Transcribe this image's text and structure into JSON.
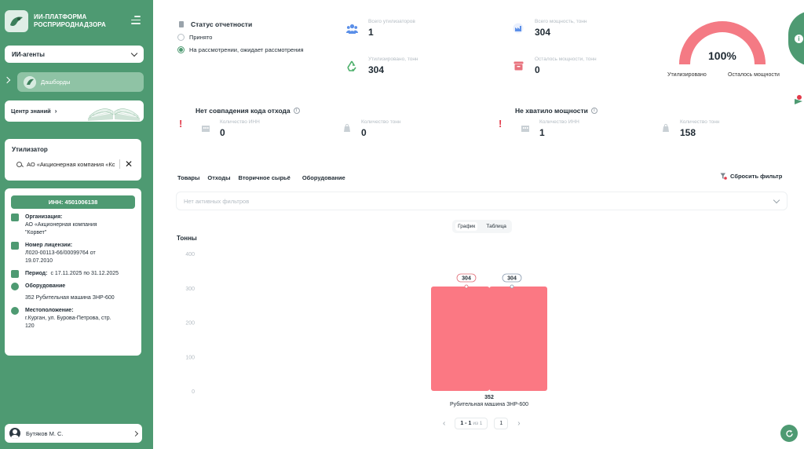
{
  "sidebar": {
    "brand_title_1": "ИИ-ПЛАТФОРМА",
    "brand_title_2": "РОСПРИРОДНАДЗОРА",
    "agents_select": "ИИ-агенты",
    "dashboards": "Дашборды",
    "knowledge": "Центр знаний",
    "knowledge_arrow": "›",
    "utilizer": {
      "title": "Утилизатор",
      "search_value": "АО «Акционерная компания «Корвет»",
      "clear": "✕"
    },
    "details": {
      "inn": "ИНН: 4501006138",
      "org_label": "Организация:",
      "org_value_1": "АО «Акционерная компания",
      "org_value_2": "\"Корвет\"",
      "license_label": "Номер лицензии:",
      "license_value_1": "Л020-00113-66/00099764 от",
      "license_value_2": "19.07.2010",
      "period_label": "Период:",
      "period_value": "с 17.11.2025 по 31.12.2025",
      "equipment_label": "Оборудование",
      "equipment_value": "352 Рубительная машина ЗНР-600",
      "location_label": "Местоположение:",
      "location_value_1": "г.Курган, ул. Бурова-Петрова, стр.",
      "location_value_2": "120"
    },
    "user_name": "Бутяков М. С."
  },
  "report_status": {
    "title": "Статус отчетности",
    "options": [
      "Принято",
      "На рассмотрении, ожидает рассмотрения"
    ],
    "selected_index": 1
  },
  "stats": {
    "total_utilizers_label": "Всего утилизаторов",
    "total_utilizers": "1",
    "total_capacity_label": "Всего мощность, тонн",
    "total_capacity": "304",
    "utilized_label": "Утилизировано, тонн",
    "utilized": "304",
    "remaining_label": "Осталось мощности, тонн",
    "remaining": "0"
  },
  "gauge": {
    "percent_text": "100%",
    "percent": 1.0,
    "left_label": "Утилизировано",
    "right_label": "Осталось мощности",
    "fill_color": "#f47a84",
    "track_color": "#f2c8cc"
  },
  "mismatch": {
    "title": "Нет совпадения кода отхода",
    "inn_label": "Количество ИНН",
    "inn_value": "0",
    "tons_label": "Количество тонн",
    "tons_value": "0"
  },
  "capacity_short": {
    "title": "Не хватило мощности",
    "inn_label": "Количество ИНН",
    "inn_value": "1",
    "tons_label": "Количество тонн",
    "tons_value": "158"
  },
  "tabs": [
    "Товары",
    "Отходы",
    "Вторичное сырьё",
    "Оборудование"
  ],
  "reset_filter": "Сбросить фильтр",
  "filter_placeholder": "Нет активных фильтров",
  "view_toggle": {
    "options": [
      "График",
      "Таблица"
    ],
    "selected": "График"
  },
  "chart_data": {
    "type": "bar",
    "ylabel": "Тонны",
    "ylim": [
      0,
      400
    ],
    "yticks": [
      0,
      100,
      200,
      300,
      400
    ],
    "categories": [
      "352 Рубительная машина ЗНР-600"
    ],
    "category_top_lines": [
      "352"
    ],
    "category_bottom_lines": [
      "Рубительная машина ЗНР-600"
    ],
    "series": [
      {
        "values": [
          304
        ],
        "color": "#fb7883",
        "label_border": "#e06c76"
      },
      {
        "values": [
          304
        ],
        "color": "#fb7883",
        "label_border": "#8a9bb0"
      }
    ],
    "data_labels": [
      "304",
      "304"
    ]
  },
  "pager": {
    "prev": "‹",
    "range": "1 - 1",
    "of": "из 1",
    "page": "1",
    "next": "›"
  },
  "colors": {
    "brand_green": "#4e9a72",
    "bar": "#fb7883",
    "warning": "#e23b4b"
  }
}
